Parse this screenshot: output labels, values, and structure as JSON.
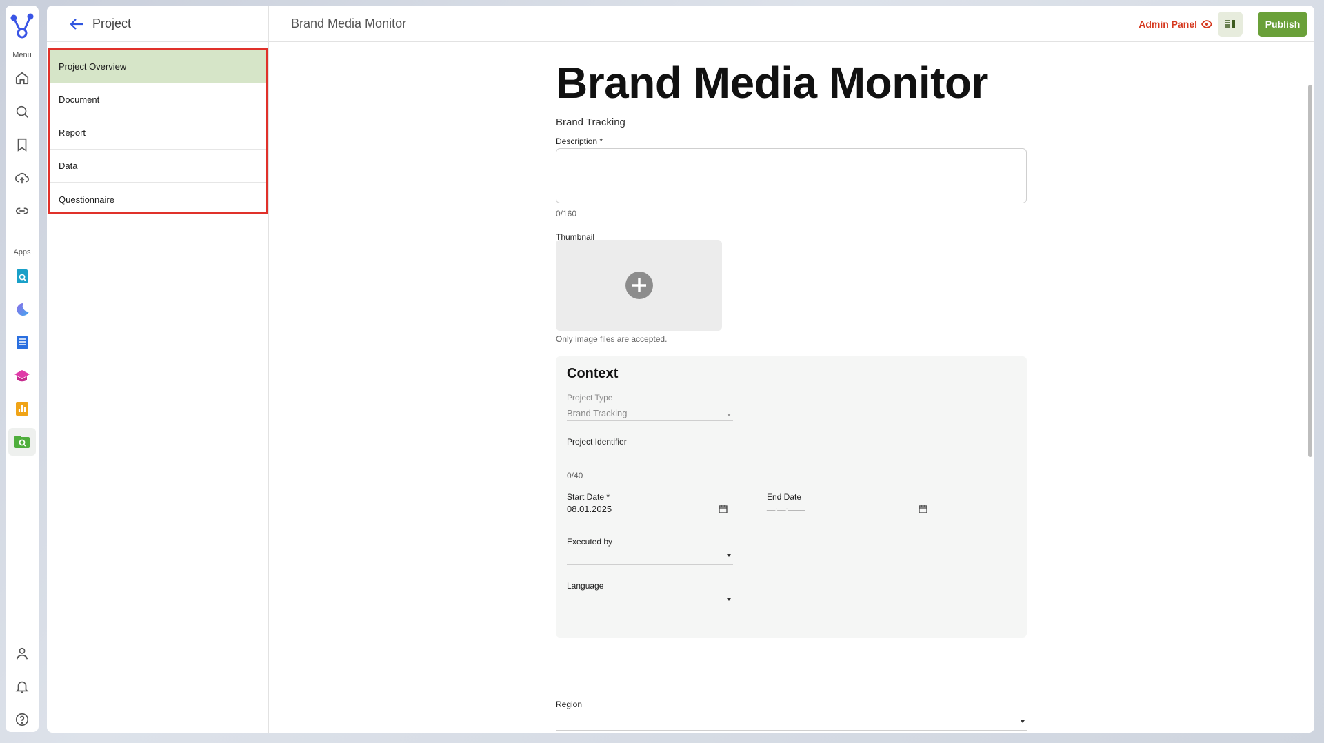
{
  "rail": {
    "menu_label": "Menu",
    "apps_label": "Apps",
    "menu_icons": [
      "home-icon",
      "search-icon",
      "bookmark-icon",
      "upload-cloud-icon",
      "link-icon"
    ],
    "app_icons": [
      "doc-search-app-icon",
      "moon-app-icon",
      "list-doc-app-icon",
      "education-app-icon",
      "bar-chart-app-icon",
      "folder-search-app-icon"
    ],
    "bottom_icons": [
      "user-icon",
      "bell-icon",
      "help-icon"
    ]
  },
  "header": {
    "back_label": "Project",
    "page_title": "Brand Media Monitor",
    "admin_panel": "Admin Panel",
    "publish": "Publish"
  },
  "sidebar": {
    "items": [
      {
        "label": "Project Overview"
      },
      {
        "label": "Document"
      },
      {
        "label": "Report"
      },
      {
        "label": "Data"
      },
      {
        "label": "Questionnaire"
      }
    ]
  },
  "main": {
    "title": "Brand Media Monitor",
    "subtitle": "Brand Tracking",
    "description_label": "Description *",
    "description_counter": "0/160",
    "thumbnail_label": "Thumbnail",
    "thumbnail_hint": "Only image files are accepted.",
    "context": {
      "title": "Context",
      "project_type_label": "Project Type",
      "project_type_value": "Brand Tracking",
      "project_identifier_label": "Project Identifier",
      "project_identifier_counter": "0/40",
      "start_date_label": "Start Date *",
      "start_date_value": "08.01.2025",
      "end_date_label": "End Date",
      "end_date_placeholder": "__.__.____",
      "executed_by_label": "Executed by",
      "language_label": "Language"
    },
    "region_label": "Region"
  },
  "colors": {
    "accent_green": "#6aa039",
    "selected_nav": "#d6e5c8",
    "highlight_border": "#e0312a",
    "admin_red": "#d6391f"
  }
}
